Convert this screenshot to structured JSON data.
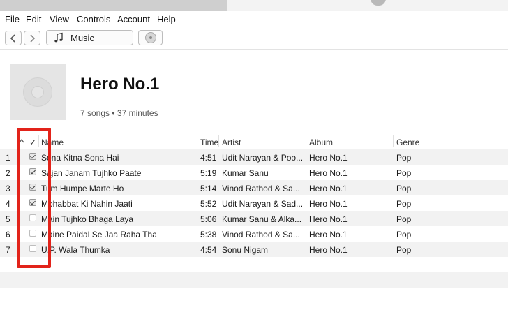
{
  "menu": [
    "File",
    "Edit",
    "View",
    "Controls",
    "Account",
    "Help"
  ],
  "toolbar": {
    "media_label": "Music"
  },
  "album": {
    "title": "Hero No.1",
    "meta": "7 songs • 37 minutes"
  },
  "table": {
    "headers": {
      "check": "✓",
      "name": "Name",
      "time": "Time",
      "artist": "Artist",
      "album": "Album",
      "genre": "Genre"
    },
    "rows": [
      {
        "num": "1",
        "checked": true,
        "name": "Sona Kitna Sona Hai",
        "time": "4:51",
        "artist": "Udit Narayan & Poo...",
        "album": "Hero No.1",
        "genre": "Pop"
      },
      {
        "num": "2",
        "checked": true,
        "name": "Sajan Janam Tujhko Paate",
        "time": "5:19",
        "artist": "Kumar Sanu",
        "album": "Hero No.1",
        "genre": "Pop"
      },
      {
        "num": "3",
        "checked": true,
        "name": "Tum Humpe Marte Ho",
        "time": "5:14",
        "artist": "Vinod Rathod & Sa...",
        "album": "Hero No.1",
        "genre": "Pop"
      },
      {
        "num": "4",
        "checked": true,
        "name": "Mohabbat Ki Nahin Jaati",
        "time": "5:52",
        "artist": "Udit Narayan & Sad...",
        "album": "Hero No.1",
        "genre": "Pop"
      },
      {
        "num": "5",
        "checked": false,
        "name": "Main Tujhko Bhaga Laya",
        "time": "5:06",
        "artist": "Kumar Sanu & Alka...",
        "album": "Hero No.1",
        "genre": "Pop"
      },
      {
        "num": "6",
        "checked": false,
        "name": "Maine Paidal Se Jaa Raha Tha",
        "time": "5:38",
        "artist": "Vinod Rathod & Sa...",
        "album": "Hero No.1",
        "genre": "Pop"
      },
      {
        "num": "7",
        "checked": false,
        "name": "U.P. Wala Thumka",
        "time": "4:54",
        "artist": "Sonu Nigam",
        "album": "Hero No.1",
        "genre": "Pop"
      }
    ]
  },
  "colors": {
    "highlight": "#e2231a",
    "row_alt": "#f2f2f2"
  }
}
